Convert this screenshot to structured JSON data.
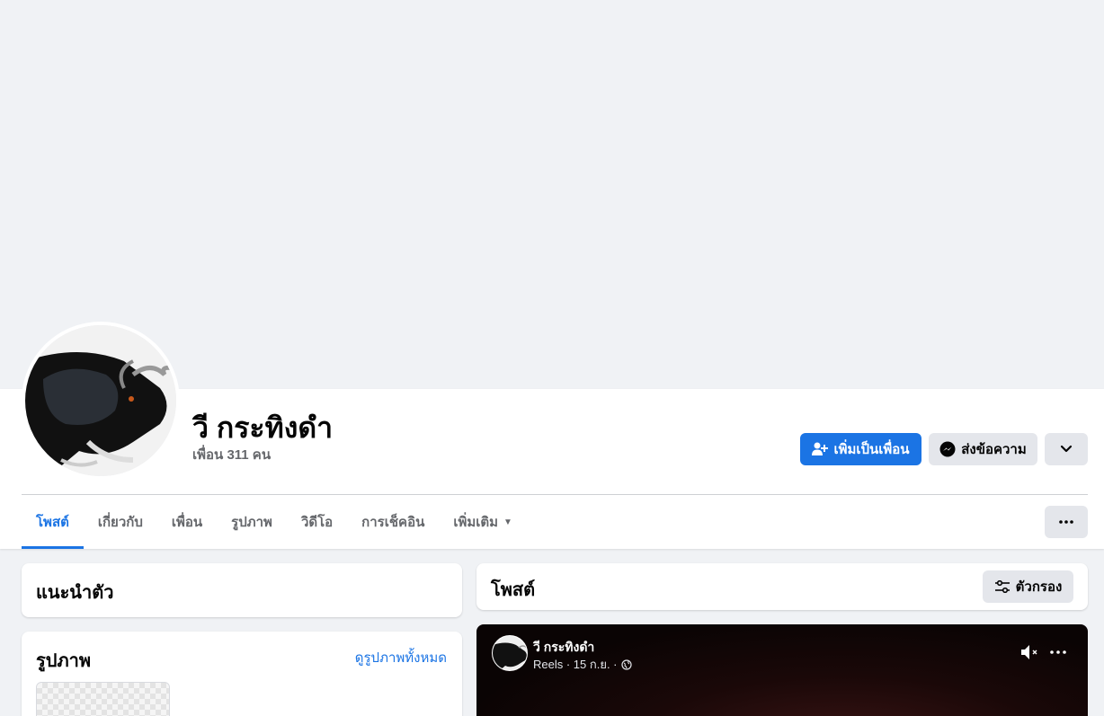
{
  "profile": {
    "name": "วี กระทิงดำ",
    "friends": "เพื่อน 311 คน"
  },
  "actions": {
    "add_friend": "เพิ่มเป็นเพื่อน",
    "message": "ส่งข้อความ"
  },
  "tabs": [
    {
      "label": "โพสต์",
      "active": true
    },
    {
      "label": "เกี่ยวกับ",
      "active": false
    },
    {
      "label": "เพื่อน",
      "active": false
    },
    {
      "label": "รูปภาพ",
      "active": false
    },
    {
      "label": "วิดีโอ",
      "active": false
    },
    {
      "label": "การเช็คอิน",
      "active": false
    },
    {
      "label": "เพิ่มเติม",
      "active": false
    }
  ],
  "intro": {
    "title": "แนะนำตัว"
  },
  "photos": {
    "title": "รูปภาพ",
    "see_all": "ดูรูปภาพทั้งหมด"
  },
  "posts": {
    "title": "โพสต์",
    "filter": "ตัวกรอง"
  },
  "reel": {
    "author": "วี กระทิงดำ",
    "meta": "Reels · 15 ก.ย. ·"
  },
  "colors": {
    "accent": "#1b74e4",
    "background": "#f0f2f5",
    "secondary_button": "#e4e6eb"
  }
}
